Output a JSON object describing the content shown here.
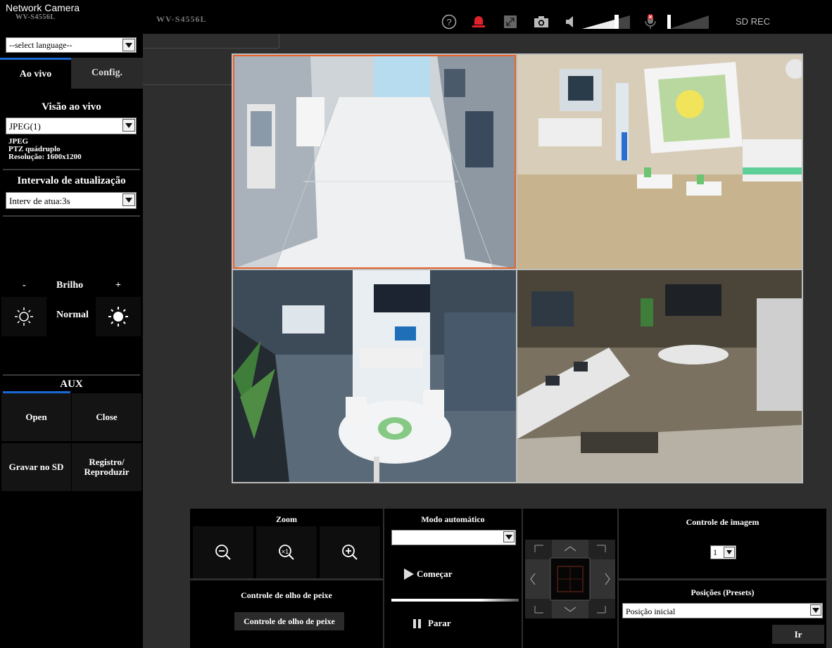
{
  "header": {
    "brand_title": "Network Camera",
    "brand_model": "WV-S4556L",
    "model_center": "WV-S4556L",
    "sd_rec": "SD REC"
  },
  "sidebar": {
    "language_placeholder": "--select language--",
    "tabs": [
      {
        "label": "Ao vivo"
      },
      {
        "label": "Config."
      }
    ],
    "live_view_title": "Visão ao vivo",
    "stream_value": "JPEG(1)",
    "stream_info": [
      "JPEG",
      "PTZ quádruplo",
      "Resolução: 1600x1200"
    ],
    "refresh_title": "Intervalo de atualização",
    "refresh_value": "Interv de atua:3s",
    "brightness": {
      "minus": "-",
      "label": "Brilho",
      "plus": "+",
      "value": "Normal"
    },
    "aux": {
      "title": "AUX",
      "open": "Open",
      "close": "Close"
    },
    "record_sd": "Gravar no SD",
    "record_play": "Registro/\nReproduzir"
  },
  "controls": {
    "zoom_title": "Zoom",
    "fisheye_title": "Controle de olho de peixe",
    "fisheye_button": "Controle de olho de peixe",
    "auto_mode_title": "Modo automático",
    "auto_mode_value": "",
    "start_label": "Começar",
    "stop_label": "Parar",
    "image_control_title": "Controle de imagem",
    "image_control_value": "1",
    "presets_title": "Posições (Presets)",
    "preset_value": "Posição inicial",
    "go_label": "Ir"
  },
  "colors": {
    "accent_blue": "#1a69d6",
    "selection_orange": "#e8622b",
    "record_red": "#e0232b"
  }
}
